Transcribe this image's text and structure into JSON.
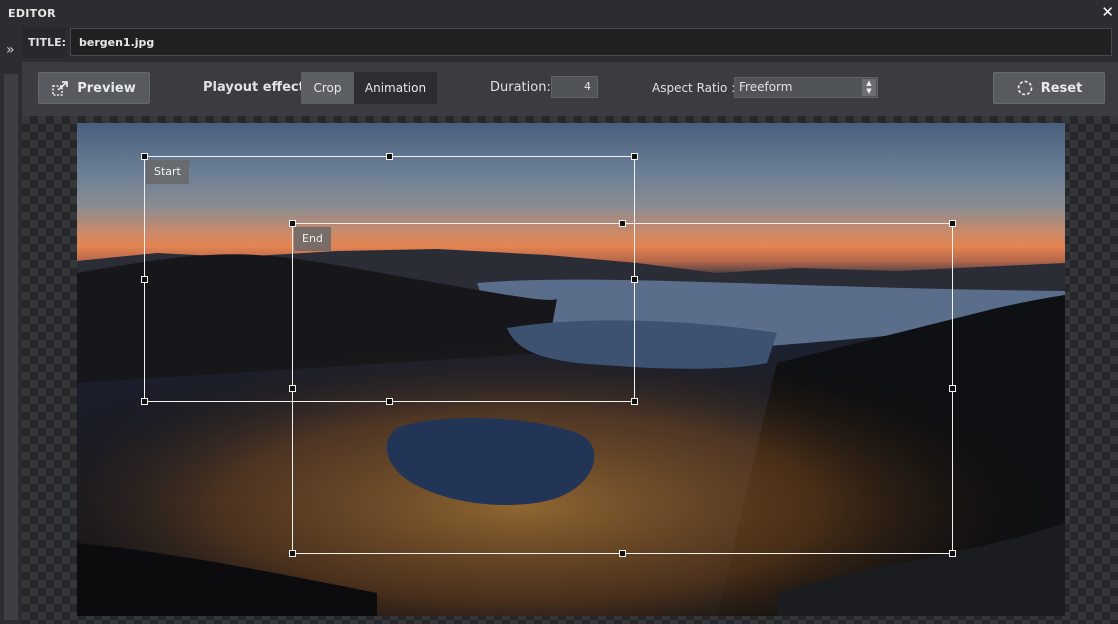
{
  "window": {
    "title": "EDITOR",
    "close_glyph": "✕"
  },
  "sidebar": {
    "expand_glyph": "»"
  },
  "title_row": {
    "label": "TITLE:",
    "value": "bergen1.jpg"
  },
  "toolbar": {
    "preview_label": "Preview",
    "playout_label": "Playout effect:",
    "effects": [
      "Crop",
      "Animation"
    ],
    "selected_effect": "Crop",
    "duration_label": "Duration:",
    "duration_value": "4",
    "aspect_label": "Aspect Ratio :",
    "aspect_value": "Freeform",
    "reset_label": "Reset"
  },
  "crop": {
    "start_label": "Start",
    "end_label": "End"
  },
  "colors": {
    "accent_dark": "#2b2d30",
    "toolbar": "#3a3c40",
    "button": "#575a5e",
    "crop_border": "#f2f2f2"
  }
}
